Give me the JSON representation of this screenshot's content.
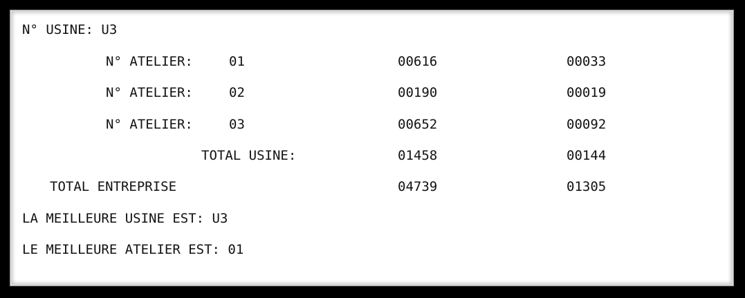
{
  "console": {
    "usine_line": "N° USINE: U3",
    "rows": [
      {
        "label": "N° ATELIER:",
        "code": "01",
        "value1": "00616",
        "value2": "00033"
      },
      {
        "label": "N° ATELIER:",
        "code": "02",
        "value1": "00190",
        "value2": "00019"
      },
      {
        "label": "N° ATELIER:",
        "code": "03",
        "value1": "00652",
        "value2": "00092"
      }
    ],
    "total_usine": {
      "label": "TOTAL USINE:",
      "value1": "01458",
      "value2": "00144"
    },
    "total_entreprise": {
      "label": "TOTAL ENTREPRISE",
      "value1": "04739",
      "value2": "01305"
    },
    "best_usine_line": "LA MEILLEURE USINE EST: U3",
    "best_atelier_line": "LE MEILLEURE ATELIER EST: 01"
  },
  "colors": {
    "background": "#ffffff",
    "text": "#111111",
    "frame": "#000000"
  }
}
